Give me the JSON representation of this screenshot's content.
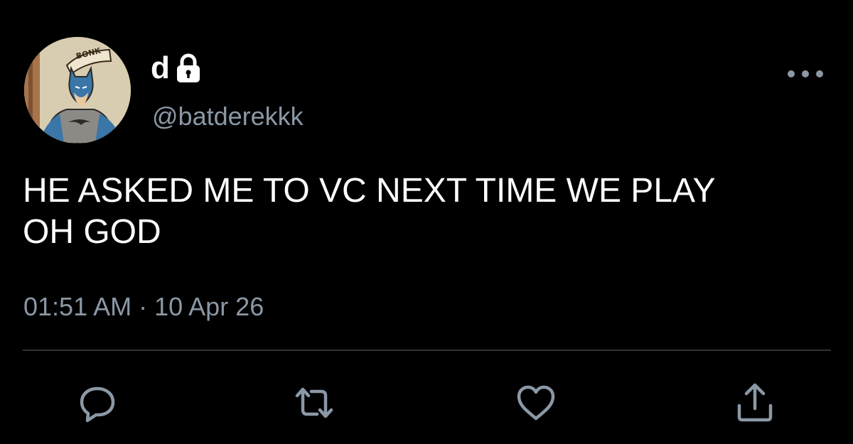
{
  "tweet": {
    "display_name": "d",
    "handle": "@batderekkk",
    "text": "HE ASKED ME TO VC NEXT TIME WE PLAY\nOH GOD",
    "timestamp": "01:51 AM · 10 Apr 26",
    "protected": true
  },
  "avatar": {
    "speech_text": "BONK"
  },
  "icons": {
    "lock": "lock-icon",
    "more": "more-options-icon",
    "reply": "reply-icon",
    "retweet": "retweet-icon",
    "like": "heart-icon",
    "share": "share-icon"
  },
  "colors": {
    "background": "#000000",
    "text": "#ffffff",
    "secondary": "#8b98a5",
    "divider": "#2f3336"
  }
}
